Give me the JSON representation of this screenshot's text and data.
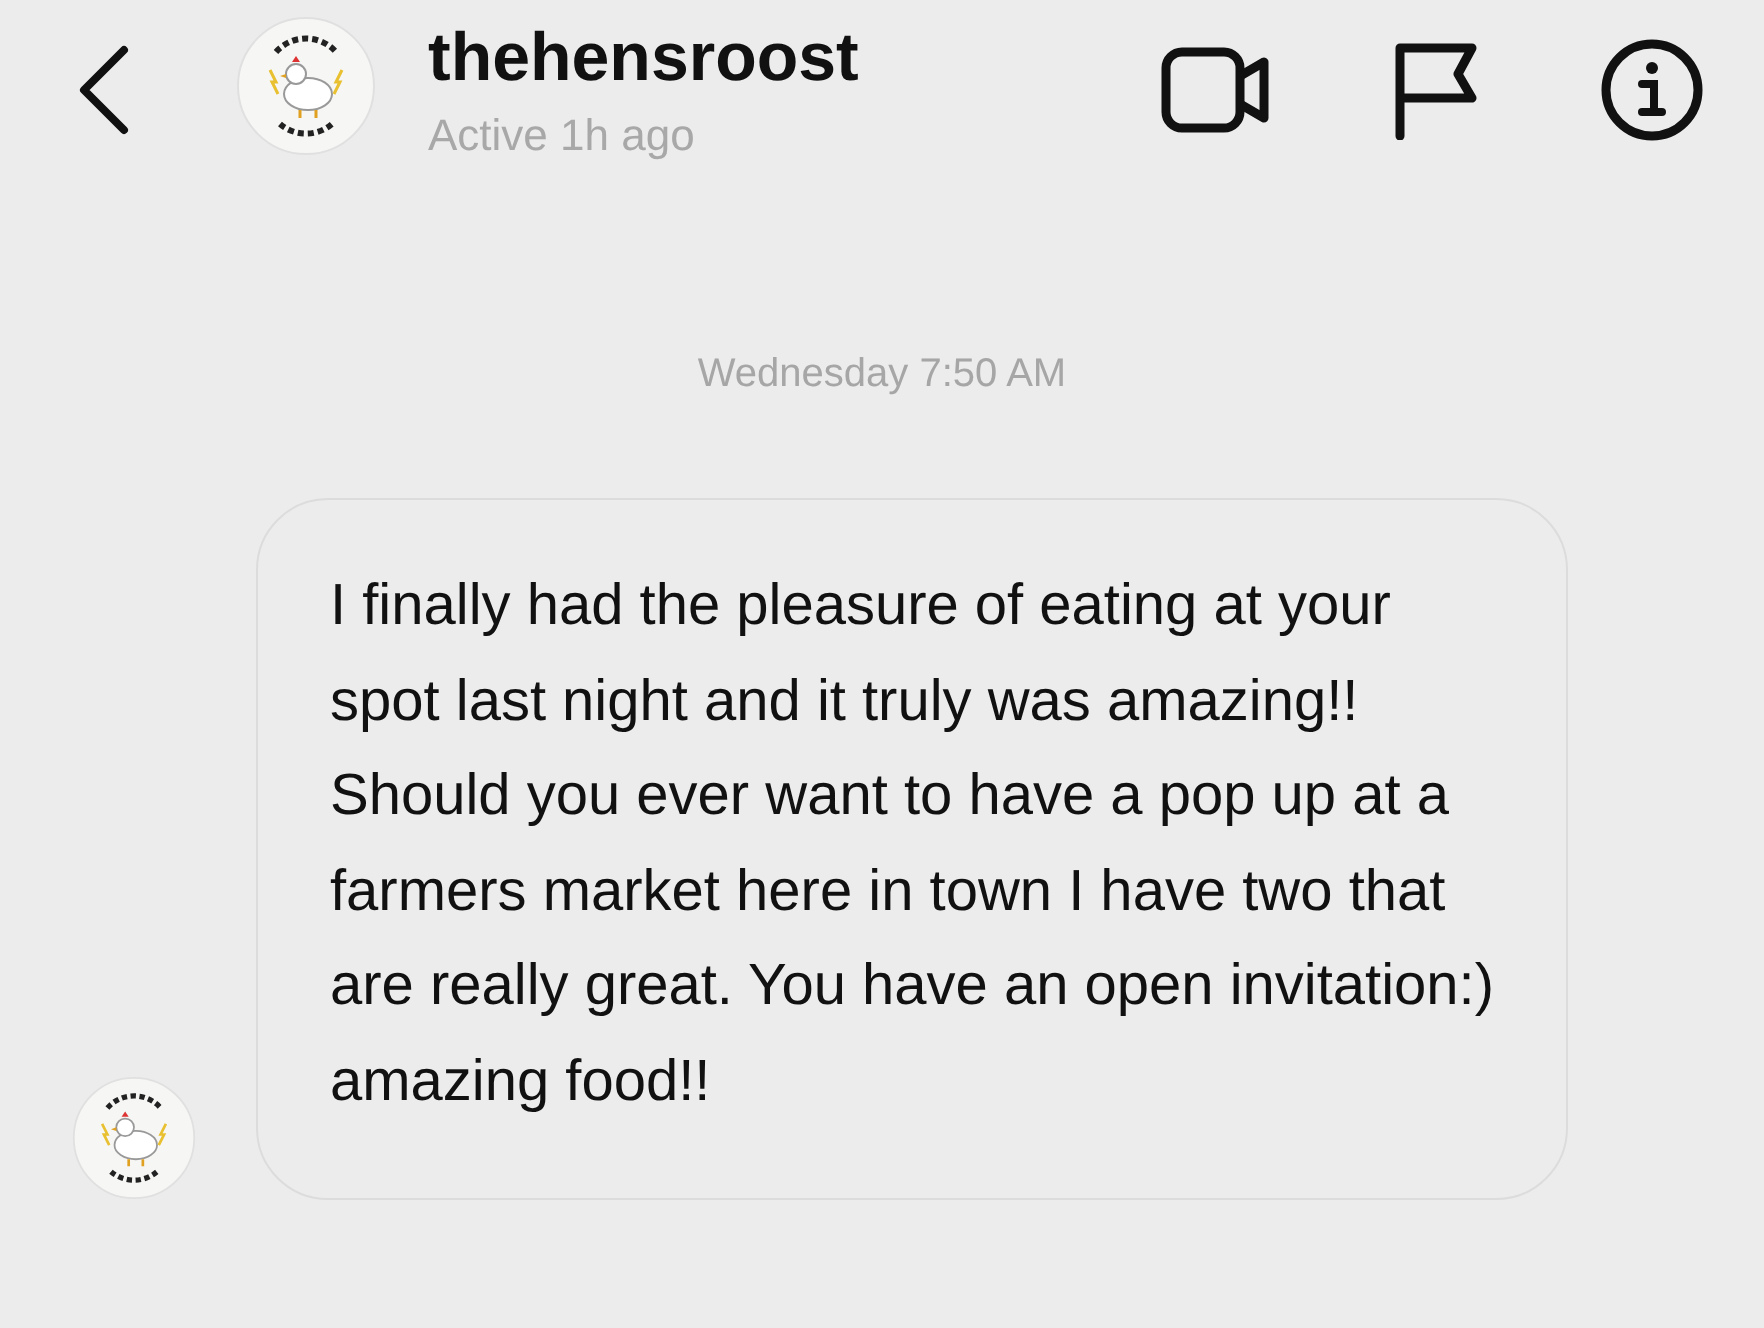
{
  "header": {
    "username": "thehensroost",
    "status": "Active 1h ago"
  },
  "timestamp": "Wednesday 7:50 AM",
  "messages": [
    {
      "text": "I finally had the pleasure of eating at your spot last night and it truly was amazing!! Should you ever want to have a pop up at a farmers market here in town I have two that are really great. You have an open invitation:) amazing food!!"
    }
  ]
}
